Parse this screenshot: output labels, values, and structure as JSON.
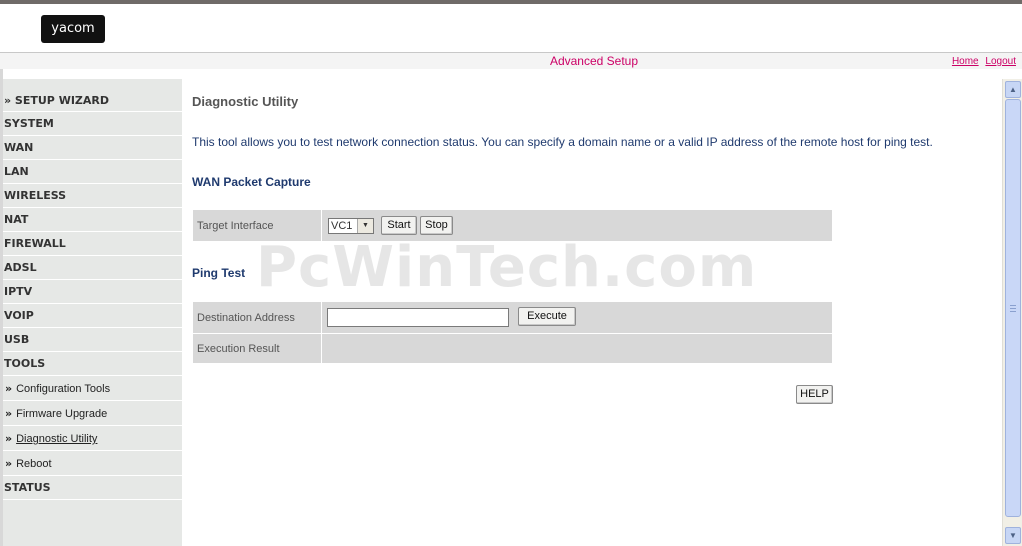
{
  "logo": {
    "text": "yacom"
  },
  "header": {
    "title": "Advanced Setup",
    "links": [
      "Home",
      "Logout"
    ]
  },
  "sidebar": {
    "items": [
      {
        "label": "» SETUP WIZARD",
        "type": "top"
      },
      {
        "label": "SYSTEM",
        "type": "top"
      },
      {
        "label": "WAN",
        "type": "top"
      },
      {
        "label": "LAN",
        "type": "top"
      },
      {
        "label": "WIRELESS",
        "type": "top"
      },
      {
        "label": "NAT",
        "type": "top"
      },
      {
        "label": "FIREWALL",
        "type": "top"
      },
      {
        "label": "ADSL",
        "type": "top"
      },
      {
        "label": "IPTV",
        "type": "top"
      },
      {
        "label": "VOIP",
        "type": "top"
      },
      {
        "label": "USB",
        "type": "top"
      },
      {
        "label": "TOOLS",
        "type": "top"
      },
      {
        "label": "Configuration Tools",
        "type": "sub"
      },
      {
        "label": "Firmware Upgrade",
        "type": "sub"
      },
      {
        "label": "Diagnostic Utility",
        "type": "sub",
        "active": true
      },
      {
        "label": "Reboot",
        "type": "sub"
      },
      {
        "label": "STATUS",
        "type": "top"
      }
    ],
    "sub_arrow": "»"
  },
  "main": {
    "title": "Diagnostic Utility",
    "description": "This tool allows you to test network connection status. You can specify a domain name or a valid IP address of the remote host for ping test.",
    "capture": {
      "heading": "WAN Packet Capture",
      "target_label": "Target Interface",
      "interface_value": "VC1",
      "start_label": "Start",
      "stop_label": "Stop"
    },
    "ping": {
      "heading": "Ping Test",
      "destination_label": "Destination Address",
      "destination_value": "",
      "execute_label": "Execute",
      "result_label": "Execution Result"
    },
    "help_label": "HELP"
  },
  "watermark": "PcWinTech.com"
}
